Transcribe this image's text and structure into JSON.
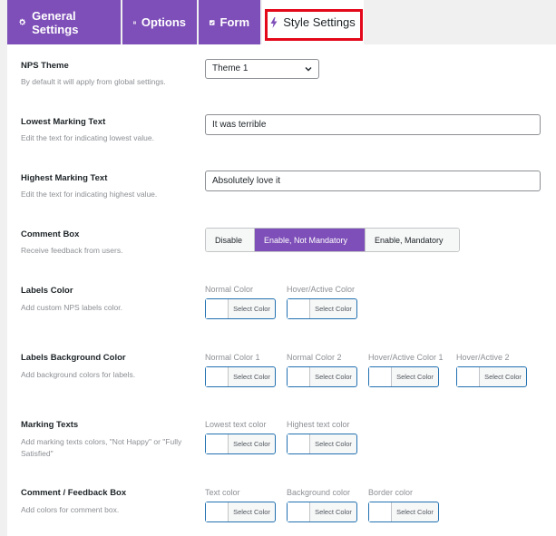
{
  "tabs": [
    {
      "label": "General Settings",
      "icon": "gear-icon"
    },
    {
      "label": "Options",
      "icon": "grid-icon"
    },
    {
      "label": "Form",
      "icon": "checkbox-icon"
    },
    {
      "label": "Style Settings",
      "icon": "bolt-icon",
      "active": true
    }
  ],
  "nps_theme": {
    "label": "NPS Theme",
    "desc": "By default it will apply from global settings.",
    "value": "Theme 1"
  },
  "lowest": {
    "label": "Lowest Marking Text",
    "desc": "Edit the text for indicating lowest value.",
    "value": "It was terrible"
  },
  "highest": {
    "label": "Highest Marking Text",
    "desc": "Edit the text for indicating highest value.",
    "value": "Absolutely love it"
  },
  "comment_box": {
    "label": "Comment Box",
    "desc": "Receive feedback from users.",
    "options": [
      "Disable",
      "Enable, Not Mandatory",
      "Enable, Mandatory"
    ],
    "selected": "Enable, Not Mandatory"
  },
  "labels_color": {
    "label": "Labels Color",
    "desc": "Add custom NPS labels color.",
    "pickers": [
      "Normal Color",
      "Hover/Active Color"
    ]
  },
  "labels_bg": {
    "label": "Labels Background Color",
    "desc": "Add background colors for labels.",
    "pickers": [
      "Normal Color 1",
      "Normal Color 2",
      "Hover/Active Color 1",
      "Hover/Active 2"
    ]
  },
  "marking_texts": {
    "label": "Marking Texts",
    "desc": "Add marking texts colors, \"Not Happy\" or \"Fully Satisfied\"",
    "pickers": [
      "Lowest text color",
      "Highest text color"
    ]
  },
  "comment_feedback": {
    "label": "Comment / Feedback Box",
    "desc": "Add colors for comment box.",
    "pickers": [
      "Text color",
      "Background color",
      "Border color"
    ]
  },
  "select_color_label": "Select Color",
  "colors": {
    "accent": "#7e4fb8",
    "highlight": "#e3081a",
    "picker_border": "#2271b1"
  }
}
